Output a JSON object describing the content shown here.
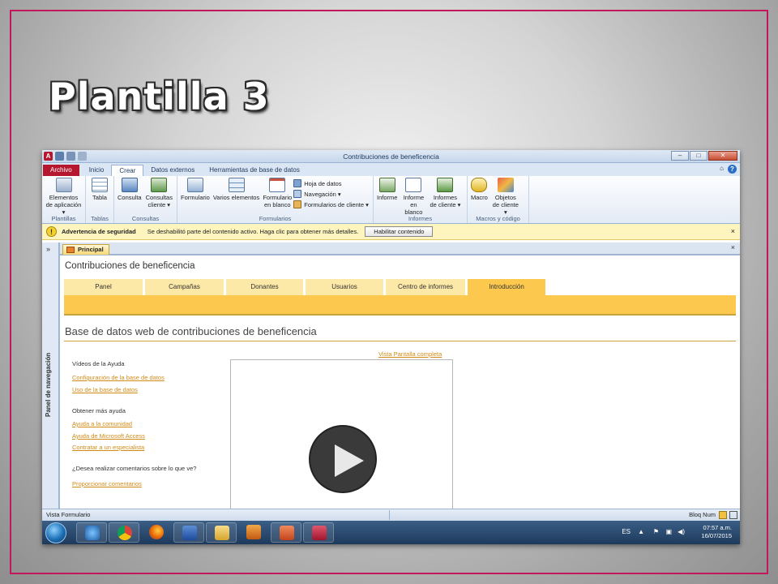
{
  "slide": {
    "title": "Plantilla 3"
  },
  "window": {
    "title": "Contribuciones de beneficencia",
    "buttons": {
      "minimize": "–",
      "maximize": "□",
      "close": "✕"
    }
  },
  "ribbon": {
    "tabs": [
      "Archivo",
      "Inicio",
      "Crear",
      "Datos externos",
      "Herramientas de base de datos"
    ],
    "active_tab": "Crear",
    "minimize_glyph": "⌂",
    "help_glyph": "?",
    "groups": {
      "plantillas": {
        "name": "Plantillas",
        "app_parts": "Elementos de aplicación ▾"
      },
      "tablas": {
        "name": "Tablas",
        "tabla": "Tabla"
      },
      "consultas": {
        "name": "Consultas",
        "consulta": "Consulta",
        "consultas_cliente": "Consultas cliente ▾"
      },
      "formularios": {
        "name": "Formularios",
        "formulario": "Formulario",
        "varios": "Varios elementos",
        "en_blanco": "Formulario en blanco",
        "hoja": "Hoja de datos",
        "navegacion": "Navegación ▾",
        "cliente": "Formularios de cliente ▾"
      },
      "informes": {
        "name": "Informes",
        "informe": "Informe",
        "en_blanco": "Informe en blanco",
        "cliente": "Informes de cliente ▾"
      },
      "macros": {
        "name": "Macros y código",
        "macro": "Macro",
        "objetos": "Objetos de cliente ▾"
      }
    }
  },
  "warning": {
    "icon": "!",
    "title": "Advertencia de seguridad",
    "message": "Se deshabilitó parte del contenido activo. Haga clic para obtener más detalles.",
    "button": "Habilitar contenido",
    "close": "×"
  },
  "nav_pane": {
    "chevron": "»",
    "label": "Panel de navegación"
  },
  "doc_tab": {
    "label": "Principal",
    "close": "×"
  },
  "form": {
    "title": "Contribuciones de beneficencia",
    "tabs": [
      "Panel",
      "Campañas",
      "Donantes",
      "Usuarios",
      "Centro de informes",
      "Introducción"
    ],
    "active_tab": "Introducción",
    "page_heading": "Base de datos web de contribuciones de beneficencia",
    "fullscreen_link": "Vista Pantalla completa",
    "help_videos_heading": "Vídeos de la Ayuda",
    "help_video_links": [
      "Configuración de la base de datos",
      "Uso de la base de datos"
    ],
    "more_help_heading": "Obtener más ayuda",
    "more_help_links": [
      "Ayuda a la comunidad",
      "Ayuda de Microsoft Access",
      "Contratar a un especialista"
    ],
    "feedback_question": "¿Desea realizar comentarios sobre lo que ve?",
    "feedback_link": "Proporcionar comentarios"
  },
  "status": {
    "left": "Vista Formulario",
    "right": "Bloq Num"
  },
  "taskbar": {
    "lang": "ES",
    "time": "07:57 a.m.",
    "date": "16/07/2015"
  },
  "colors": {
    "frame": "#c2185b",
    "access_red": "#b5172f",
    "form_accent": "#fcc94e",
    "link": "#d18b17"
  }
}
